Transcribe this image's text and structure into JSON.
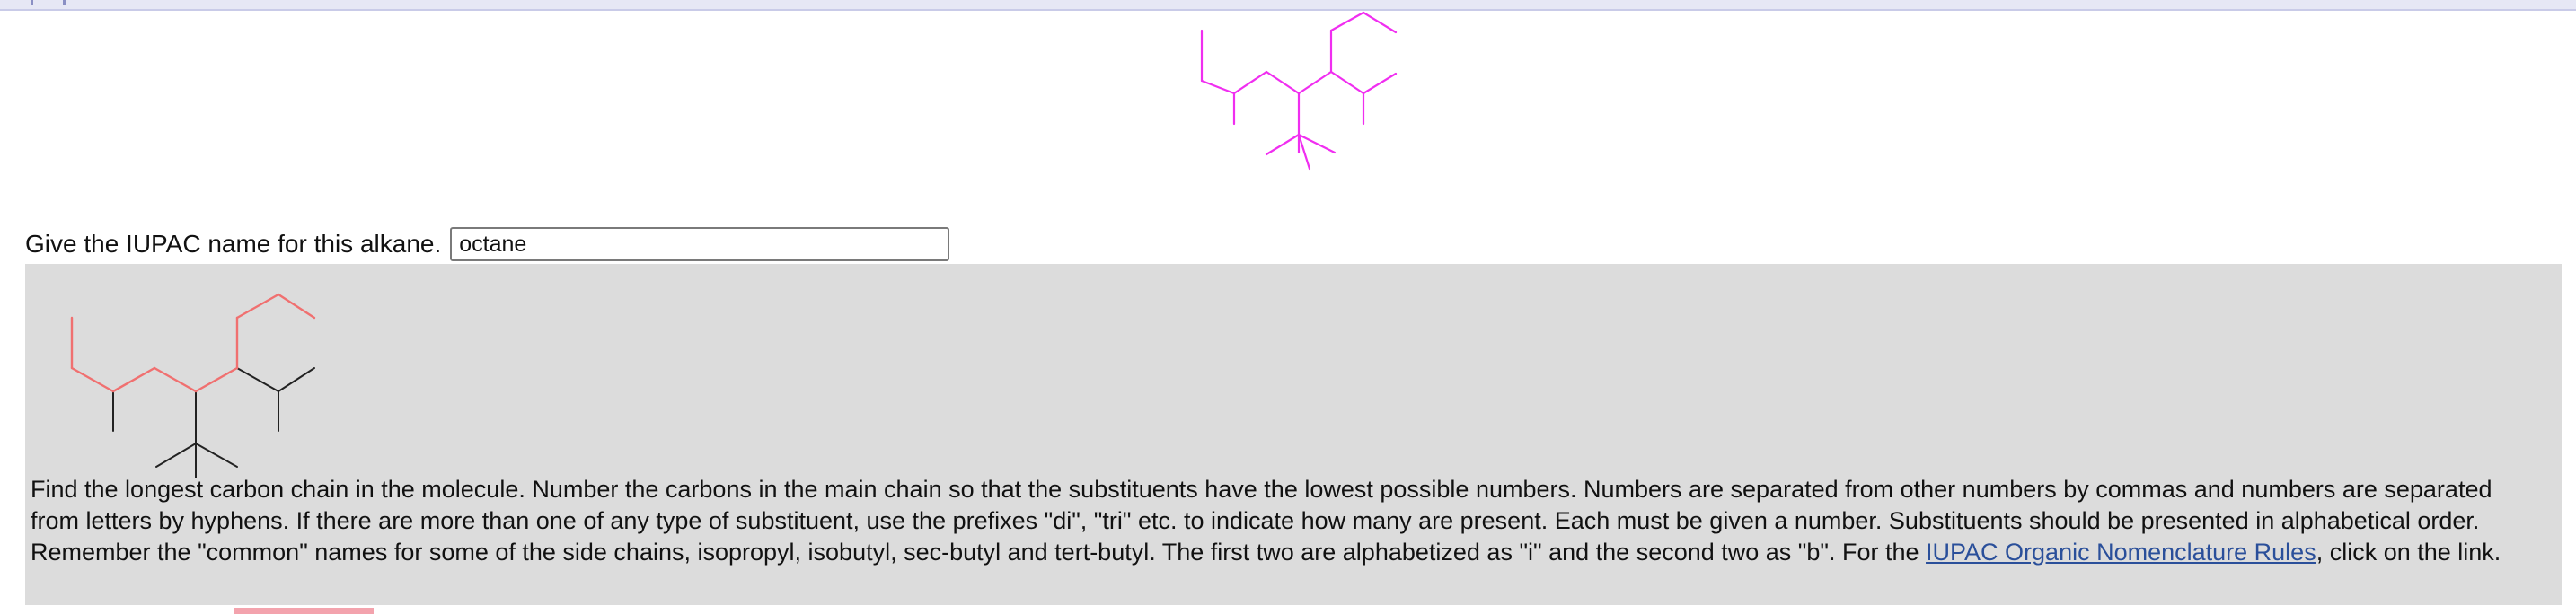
{
  "question": {
    "label": "Give the IUPAC name for this alkane.",
    "answer_value": "octane",
    "answer_placeholder": ""
  },
  "colors": {
    "question_bonds": "#f02ef0",
    "main_chain": "#f07070",
    "substituent_bonds": "#222222",
    "feedback_background": "#dcdcdc",
    "link": "#2a4f9a"
  },
  "feedback": {
    "hint_before_link": "Find the longest carbon chain in the molecule. Number the carbons in the main chain so that the substituents have the lowest possible numbers. Numbers are separated from other numbers by commas and numbers are separated from letters by hyphens. If there are more than one of any type of substituent, use the prefixes \"di\", \"tri\" etc. to indicate how many are present. Each must be given a number. Substituents should be presented in alphabetical order. Remember the \"common\" names for some of the side chains, isopropyl, isobutyl, sec-butyl and tert-butyl. The first two are alphabetized as \"i\" and the second two as \"b\". For the ",
    "link_text": "IUPAC Organic Nomenclature Rules",
    "hint_after_link": ", click on the link."
  }
}
